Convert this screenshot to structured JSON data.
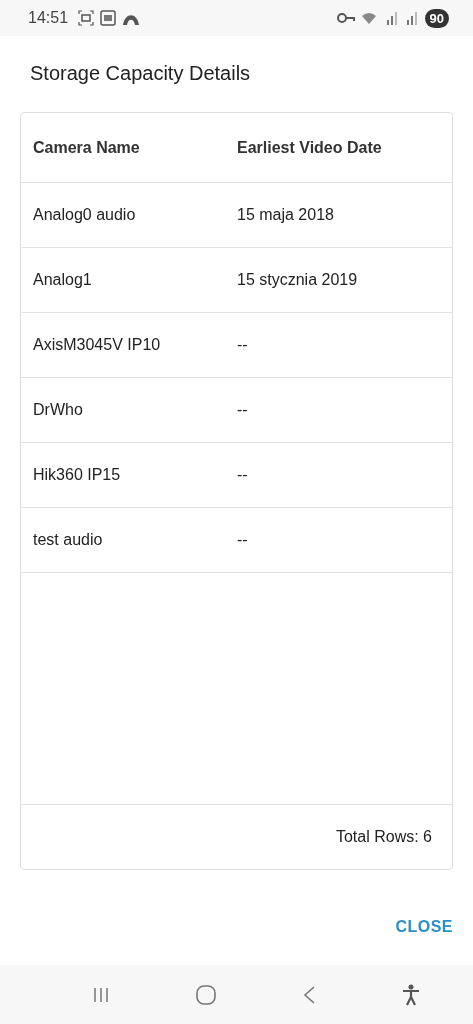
{
  "status_bar": {
    "time": "14:51",
    "battery": "90"
  },
  "dialog": {
    "title": "Storage Capacity Details",
    "table": {
      "columns": [
        "Camera Name",
        "Earliest Video Date"
      ],
      "rows": [
        {
          "camera": "Analog0 audio",
          "date": "15 maja 2018"
        },
        {
          "camera": "Analog1",
          "date": "15 stycznia 2019"
        },
        {
          "camera": "AxisM3045V IP10",
          "date": "--"
        },
        {
          "camera": "DrWho",
          "date": "--"
        },
        {
          "camera": "Hik360 IP15",
          "date": "--"
        },
        {
          "camera": "test audio",
          "date": "--"
        }
      ],
      "footer": "Total Rows: 6"
    },
    "buttons": [
      "CLOSE"
    ]
  }
}
